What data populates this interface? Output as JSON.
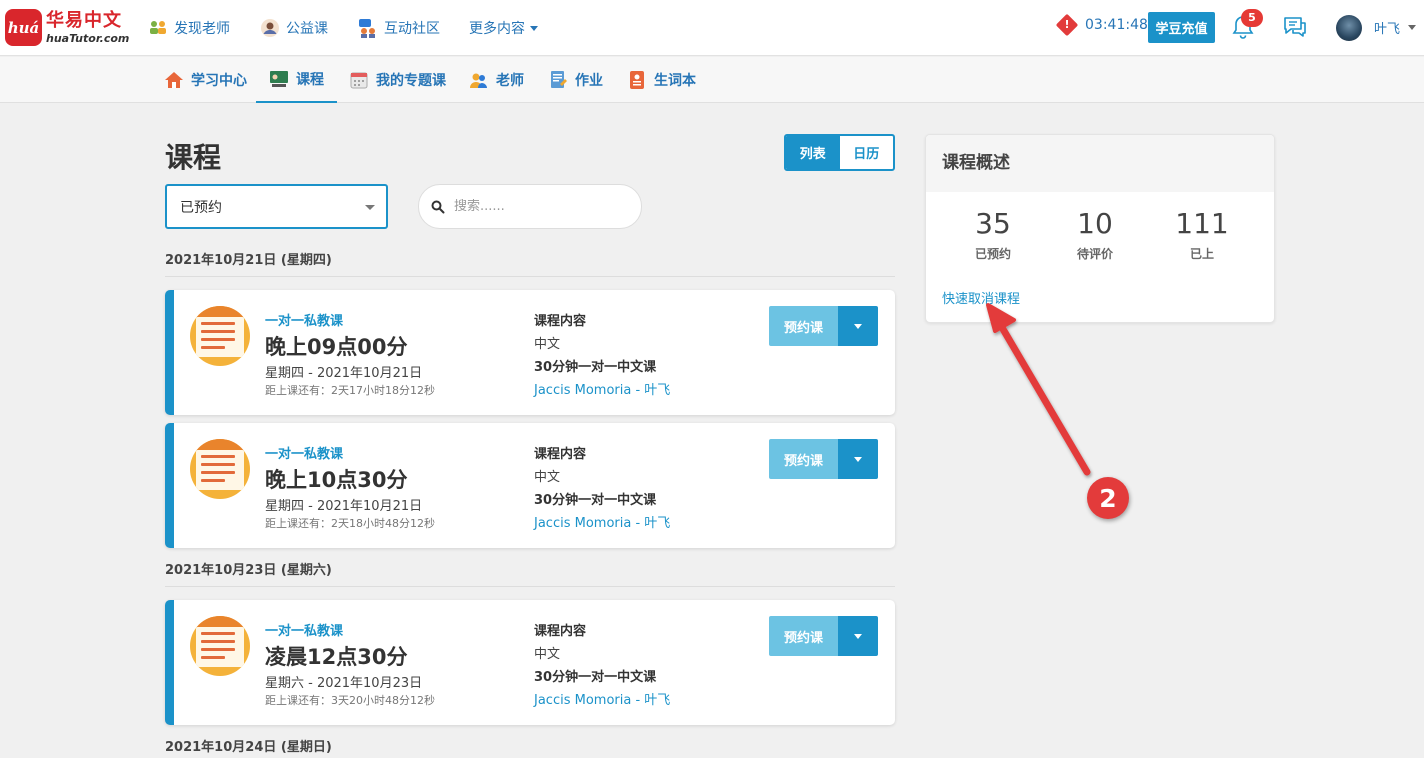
{
  "logo": {
    "badge": "huá",
    "cn": "华易中文",
    "en": "huaTutor.com"
  },
  "topnav": {
    "items": [
      {
        "label": "发现老师",
        "icon": "teachers-icon"
      },
      {
        "label": "公益课",
        "icon": "user-circle-icon"
      },
      {
        "label": "互动社区",
        "icon": "community-icon"
      }
    ],
    "more_label": "更多内容",
    "timer": "03:41:48",
    "recharge_label": "学豆充值",
    "notification_count": "5",
    "username": "叶飞"
  },
  "subnav": [
    {
      "label": "学习中心",
      "icon": "home-icon"
    },
    {
      "label": "课程",
      "icon": "classroom-icon"
    },
    {
      "label": "我的专题课",
      "icon": "calendar-icon"
    },
    {
      "label": "老师",
      "icon": "teacher-icon"
    },
    {
      "label": "作业",
      "icon": "homework-icon"
    },
    {
      "label": "生词本",
      "icon": "vocab-book-icon"
    }
  ],
  "main": {
    "title": "课程",
    "view_toggle": {
      "list": "列表",
      "calendar": "日历"
    },
    "filter_value": "已预约",
    "search_placeholder": "搜索......"
  },
  "groups": [
    {
      "date": "2021年10月21日 (星期四)",
      "lessons": [
        {
          "type": "一对一私教课",
          "time": "晚上09点00分",
          "date": "星期四 - 2021年10月21日",
          "countdown": "距上课还有：2天17小时18分12秒",
          "content_header": "课程内容",
          "language": "中文",
          "title": "30分钟一对一中文课",
          "people": "Jaccis Momoria - 叶飞",
          "book_label": "预约课"
        },
        {
          "type": "一对一私教课",
          "time": "晚上10点30分",
          "date": "星期四 - 2021年10月21日",
          "countdown": "距上课还有：2天18小时48分12秒",
          "content_header": "课程内容",
          "language": "中文",
          "title": "30分钟一对一中文课",
          "people": "Jaccis Momoria - 叶飞",
          "book_label": "预约课"
        }
      ]
    },
    {
      "date": "2021年10月23日 (星期六)",
      "lessons": [
        {
          "type": "一对一私教课",
          "time": "凌晨12点30分",
          "date": "星期六 - 2021年10月23日",
          "countdown": "距上课还有：3天20小时48分12秒",
          "content_header": "课程内容",
          "language": "中文",
          "title": "30分钟一对一中文课",
          "people": "Jaccis Momoria - 叶飞",
          "book_label": "预约课"
        }
      ]
    },
    {
      "date": "2021年10月24日 (星期日)",
      "lessons": []
    }
  ],
  "overview": {
    "title": "课程概述",
    "stats": [
      {
        "num": "35",
        "label": "已预约"
      },
      {
        "num": "10",
        "label": "待评价"
      },
      {
        "num": "111",
        "label": "已上"
      }
    ],
    "quick_cancel": "快速取消课程"
  },
  "annotation": {
    "step": "2",
    "color": "#e33b3b"
  },
  "colors": {
    "accent": "#1b92c9",
    "brand": "#d9262c",
    "book_button": "#6cc3e3"
  }
}
